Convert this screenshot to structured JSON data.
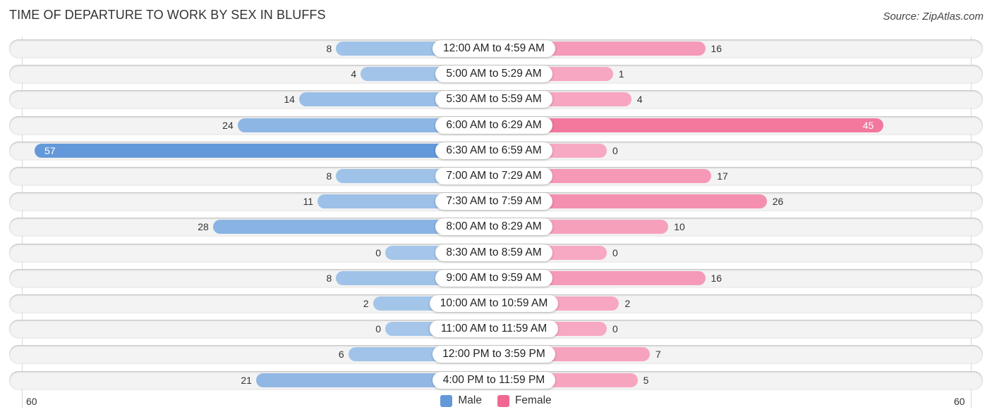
{
  "header": {
    "title": "TIME OF DEPARTURE TO WORK BY SEX IN BLUFFS",
    "source": "Source: ZipAtlas.com"
  },
  "colors": {
    "male_strong": "#6399d9",
    "male_light": "#a5c6ea",
    "female_strong": "#f06892",
    "female_light": "#f7a8c2"
  },
  "legend": {
    "male_label": "Male",
    "female_label": "Female"
  },
  "axis": {
    "left_tick": "60",
    "right_tick": "60"
  },
  "chart_data": {
    "type": "bar",
    "orientation": "horizontal-diverging",
    "title": "TIME OF DEPARTURE TO WORK BY SEX IN BLUFFS",
    "xlabel": "",
    "ylabel": "",
    "xlim": [
      -60,
      60
    ],
    "legend_position": "bottom-center",
    "categories": [
      "12:00 AM to 4:59 AM",
      "5:00 AM to 5:29 AM",
      "5:30 AM to 5:59 AM",
      "6:00 AM to 6:29 AM",
      "6:30 AM to 6:59 AM",
      "7:00 AM to 7:29 AM",
      "7:30 AM to 7:59 AM",
      "8:00 AM to 8:29 AM",
      "8:30 AM to 8:59 AM",
      "9:00 AM to 9:59 AM",
      "10:00 AM to 10:59 AM",
      "11:00 AM to 11:59 AM",
      "12:00 PM to 3:59 PM",
      "4:00 PM to 11:59 PM"
    ],
    "series": [
      {
        "name": "Male",
        "values": [
          8,
          4,
          14,
          24,
          57,
          8,
          11,
          28,
          0,
          8,
          2,
          0,
          6,
          21
        ]
      },
      {
        "name": "Female",
        "values": [
          16,
          1,
          4,
          45,
          0,
          17,
          26,
          10,
          0,
          16,
          2,
          0,
          7,
          5
        ]
      }
    ]
  }
}
